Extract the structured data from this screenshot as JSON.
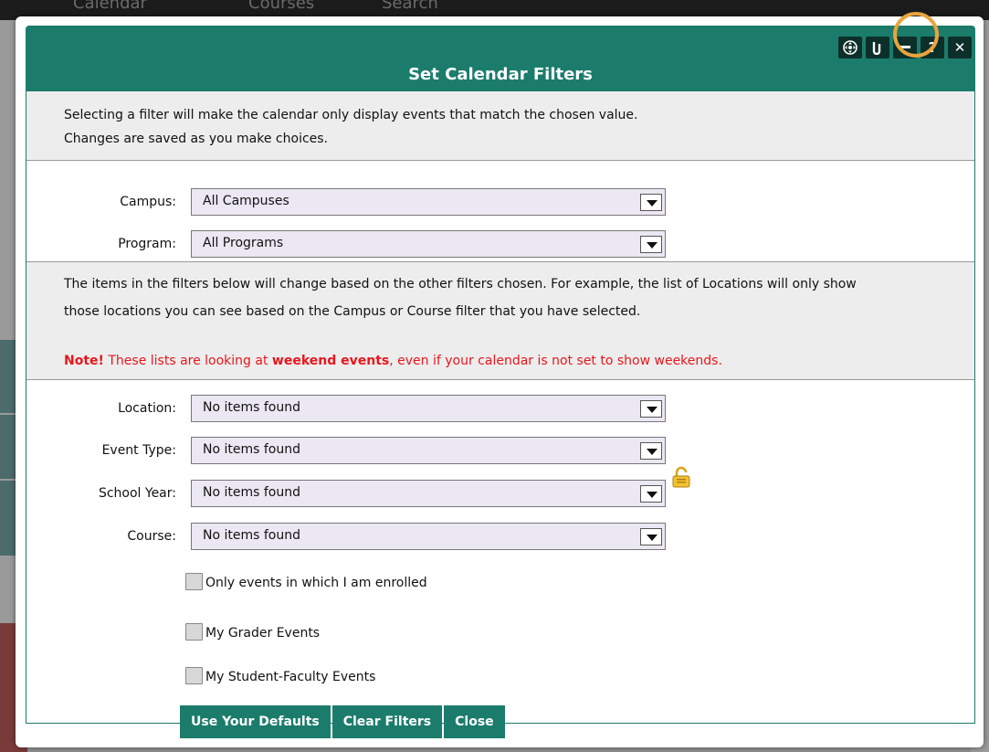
{
  "background": {
    "tabs": [
      "Calendar",
      "Courses",
      "Search"
    ]
  },
  "dialog": {
    "title": "Set Calendar Filters",
    "header_icons": [
      "move-icon",
      "undo-icon",
      "minimize-icon",
      "help-icon",
      "close-icon"
    ],
    "intro_lines": [
      "Selecting a filter will make the calendar only display events that match the chosen value.",
      "Changes are saved as you make choices."
    ],
    "campus": {
      "label": "Campus:",
      "value": "All Campuses"
    },
    "program": {
      "label": "Program:",
      "value": "All Programs"
    },
    "info_lines": [
      "The items in the filters below will change based on the other filters chosen. For example, the list of Locations will only show",
      "those locations you can see based on the Campus or Course filter that you have selected."
    ],
    "note": {
      "prefix": "Note!",
      "text_before": " These lists are looking at ",
      "bold": "weekend events",
      "text_after": ", even if your calendar is not set to show weekends."
    },
    "location": {
      "label": "Location:",
      "value": "No items found"
    },
    "event_type": {
      "label": "Event Type:",
      "value": "No items found"
    },
    "school_year": {
      "label": "School Year:",
      "value": "No items found"
    },
    "course": {
      "label": "Course:",
      "value": "No items found"
    },
    "checkboxes": [
      {
        "label": "Only events in which I am enrolled",
        "checked": false
      },
      {
        "label": "My Grader Events",
        "checked": false
      },
      {
        "label": "My Student-Faculty Events",
        "checked": false
      }
    ],
    "buttons": {
      "defaults": "Use Your Defaults",
      "clear": "Clear Filters",
      "close": "Close"
    },
    "colors": {
      "header": "#1b7c6c",
      "note": "#e8161c",
      "highlight": "#e8a43d"
    }
  }
}
